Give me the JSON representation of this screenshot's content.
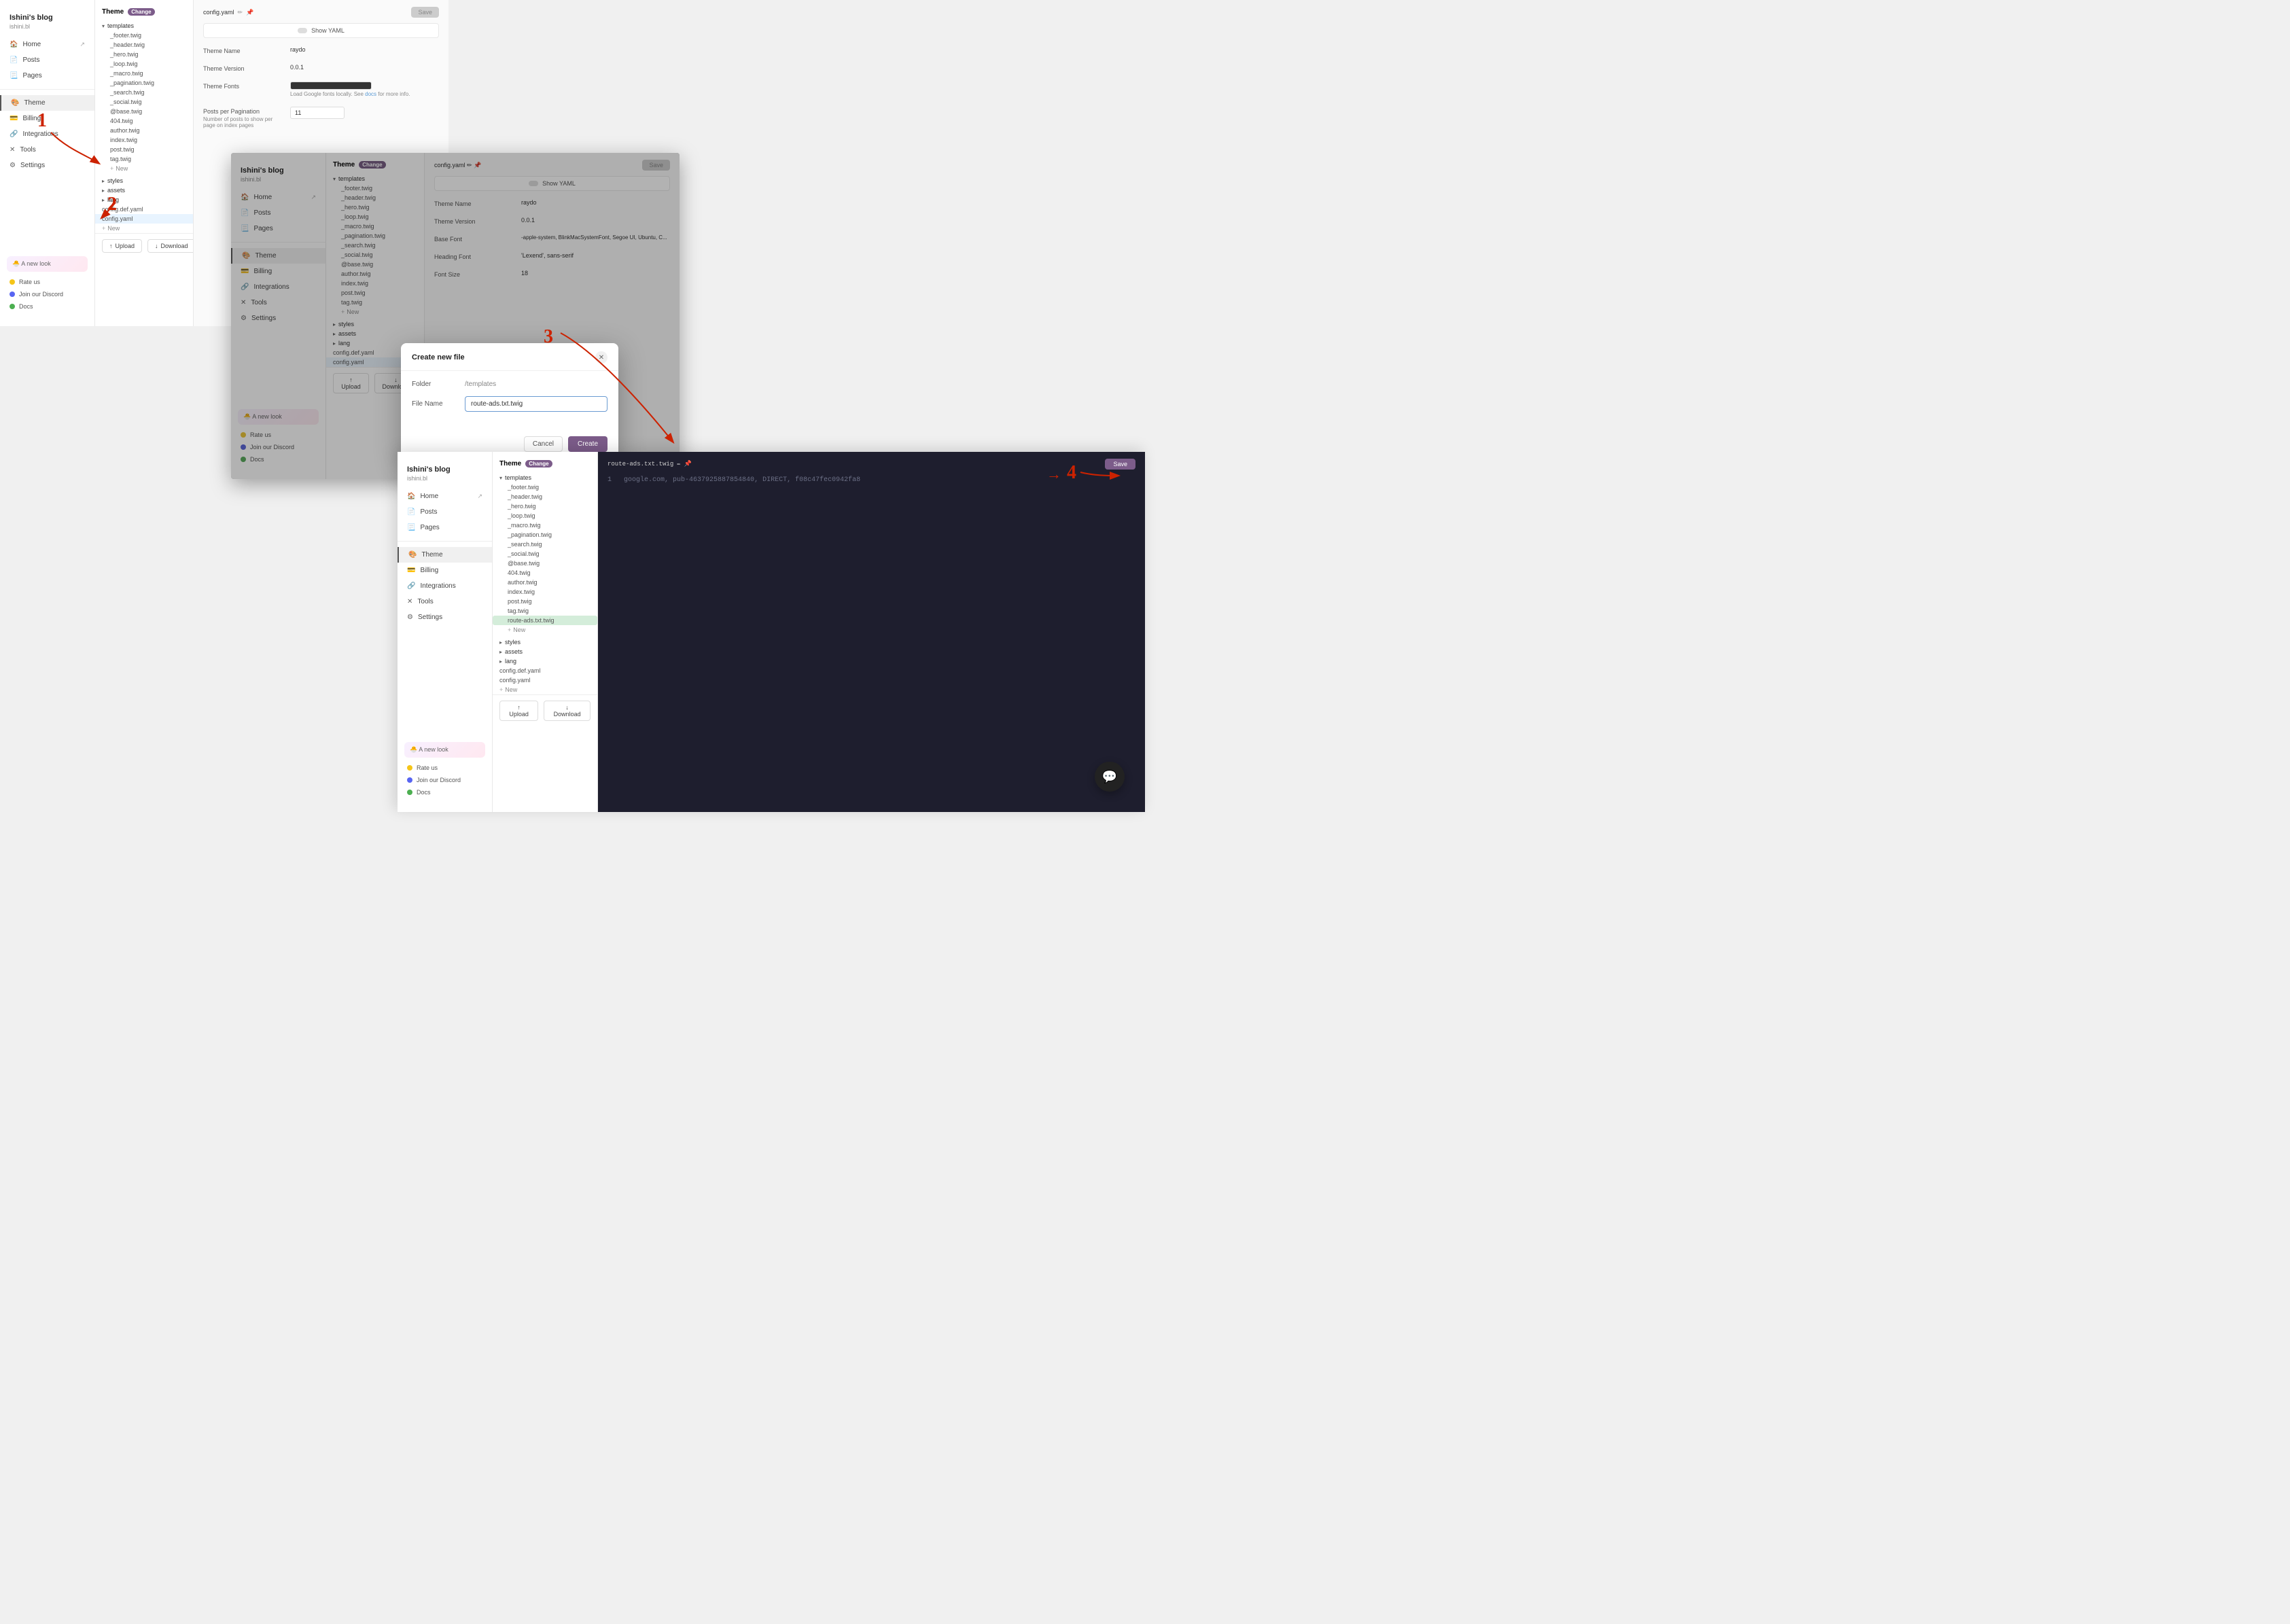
{
  "app": {
    "blog_title": "Ishini's blog",
    "blog_url": "ishini.bl",
    "nav": [
      {
        "id": "home",
        "label": "Home",
        "icon": "🏠",
        "external": true
      },
      {
        "id": "posts",
        "label": "Posts",
        "icon": "📄",
        "external": false
      },
      {
        "id": "pages",
        "label": "Pages",
        "icon": "📃",
        "external": false
      },
      {
        "id": "theme",
        "label": "Theme",
        "icon": "🎨",
        "external": false,
        "active": true
      },
      {
        "id": "billing",
        "label": "Billing",
        "icon": "💳",
        "external": false
      },
      {
        "id": "integrations",
        "label": "Integrations",
        "icon": "🔗",
        "external": false
      },
      {
        "id": "tools",
        "label": "Tools",
        "icon": "✕",
        "external": false
      },
      {
        "id": "settings",
        "label": "Settings",
        "icon": "⚙",
        "external": false
      }
    ],
    "promo": "🐣 A new look",
    "bottom_links": [
      {
        "id": "rate",
        "label": "Rate us",
        "color": "star"
      },
      {
        "id": "discord",
        "label": "Join our Discord",
        "color": "discord"
      },
      {
        "id": "docs",
        "label": "Docs",
        "color": "docs"
      }
    ]
  },
  "theme_panel": {
    "title": "Theme",
    "badge": "Change"
  },
  "file_tree": {
    "templates_folder": "templates",
    "templates_files": [
      "_footer.twig",
      "_header.twig",
      "_hero.twig",
      "_loop.twig",
      "_macro.twig",
      "_pagination.twig",
      "_search.twig",
      "_social.twig",
      "@base.twig",
      "404.twig",
      "author.twig",
      "index.twig",
      "post.twig",
      "tag.twig",
      "route-ads.txt.twig"
    ],
    "styles_folder": "styles",
    "assets_folder": "assets",
    "lang_folder": "lang",
    "config_def": "config.def.yaml",
    "config_yaml": "config.yaml",
    "new_label": "+ New"
  },
  "config": {
    "filename": "config.yaml",
    "show_yaml_label": "Show YAML",
    "fields": {
      "theme_name_label": "Theme Name",
      "theme_name_value": "raydo",
      "theme_version_label": "Theme Version",
      "theme_version_value": "0.0.1",
      "theme_fonts_label": "Theme Fonts",
      "theme_fonts_subtext1": "Load Google fonts locally. See",
      "theme_fonts_link": "docs",
      "theme_fonts_subtext2": "for more info.",
      "posts_per_page_label": "Posts per Pagination",
      "posts_per_page_desc": "Number of posts to show per page on index pages",
      "posts_per_page_value": "11",
      "base_font_label": "Base Font",
      "base_font_value": "-apple-system, BlinkMacSystemFont, Segoe UI, Ubuntu, C...",
      "heading_font_label": "Heading Font",
      "heading_font_value": "'Lexend', sans-serif",
      "font_size_label": "Font Size",
      "font_size_value": "18"
    },
    "save_label": "Save"
  },
  "dialog": {
    "title": "Create new file",
    "folder_label": "Folder",
    "folder_value": "/templates",
    "filename_label": "File Name",
    "filename_value": "route-ads.txt.twig",
    "cancel_label": "Cancel",
    "create_label": "Create"
  },
  "bottom_panel": {
    "editor_filename": "route-ads.txt.twig",
    "save_label": "Save",
    "code_line1": "google.com, pub-4637925887854840, DIRECT, f08c47fec0942fa8"
  },
  "steps": {
    "step1": "1",
    "step2": "2",
    "step3": "3",
    "step4": "4"
  },
  "chat": {
    "icon": "💬"
  },
  "bottom_sidebar_nav": [
    {
      "id": "home",
      "label": "Home",
      "icon": "🏠",
      "external": true
    },
    {
      "id": "posts",
      "label": "Posts",
      "icon": "📄"
    },
    {
      "id": "pages",
      "label": "Pages",
      "icon": "📃"
    },
    {
      "id": "theme",
      "label": "Theme",
      "icon": "🎨",
      "active": true
    },
    {
      "id": "billing",
      "label": "Billing",
      "icon": "💳"
    },
    {
      "id": "integrations",
      "label": "Integrations",
      "icon": "🔗"
    },
    {
      "id": "tools",
      "label": "Tools",
      "icon": "✕"
    },
    {
      "id": "settings",
      "label": "Settings",
      "icon": "⚙"
    }
  ]
}
